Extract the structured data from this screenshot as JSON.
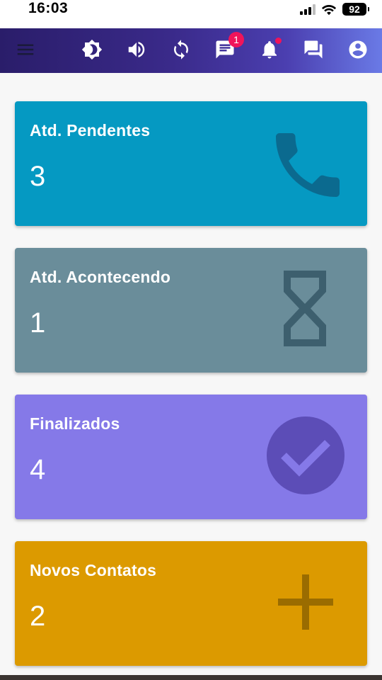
{
  "status_bar": {
    "time": "16:03",
    "battery": "92"
  },
  "app_bar": {
    "icons": [
      "menu-icon",
      "brightness-icon",
      "volume-icon",
      "sync-icon",
      "message-icon",
      "notification-bell-icon",
      "forum-icon",
      "account-circle-icon"
    ],
    "messages_badge": "1"
  },
  "cards": [
    {
      "title": "Atd. Pendentes",
      "count": "3",
      "icon": "phone-icon",
      "color": "#0599c2"
    },
    {
      "title": "Atd. Acontecendo",
      "count": "1",
      "icon": "hourglass-icon",
      "color": "#6a8d9a"
    },
    {
      "title": "Finalizados",
      "count": "4",
      "icon": "check-circle-icon",
      "color": "#8579e8"
    },
    {
      "title": "Novos Contatos",
      "count": "2",
      "icon": "plus-icon",
      "color": "#dc9a00"
    }
  ]
}
